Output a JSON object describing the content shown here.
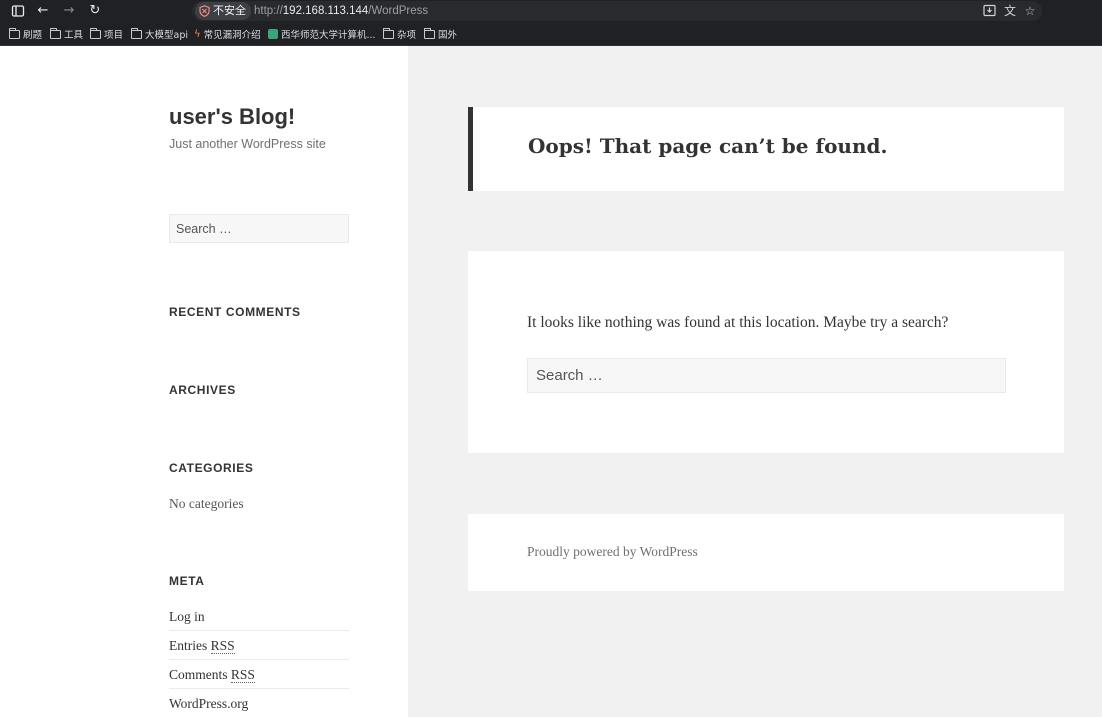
{
  "browser": {
    "security_label": "不安全",
    "url_scheme": "http://",
    "url_host": "192.168.113.144",
    "url_path": "/WordPress",
    "bookmarks": [
      {
        "label": "刷题",
        "icon": "folder-icon"
      },
      {
        "label": "工具",
        "icon": "folder-icon"
      },
      {
        "label": "项目",
        "icon": "folder-icon"
      },
      {
        "label": "大模型api",
        "icon": "folder-icon"
      },
      {
        "label": "常见漏洞介绍",
        "icon": "bolt-icon"
      },
      {
        "label": "西华师范大学计算机...",
        "icon": "site-icon"
      },
      {
        "label": "杂项",
        "icon": "folder-icon"
      },
      {
        "label": "国外",
        "icon": "folder-icon"
      }
    ]
  },
  "site": {
    "title": "user's Blog!",
    "description": "Just another WordPress site"
  },
  "sidebar": {
    "search_placeholder": "Search …",
    "recent_comments_title": "RECENT COMMENTS",
    "archives_title": "ARCHIVES",
    "categories_title": "CATEGORIES",
    "categories_empty": "No categories",
    "meta_title": "META",
    "meta_links": {
      "login": "Log in",
      "entries_prefix": "Entries ",
      "comments_prefix": "Comments ",
      "rss": "RSS",
      "wordpress_org": "WordPress.org"
    }
  },
  "main": {
    "error_title": "Oops! That page can’t be found.",
    "error_text": "It looks like nothing was found at this location. Maybe try a search?",
    "search_placeholder": "Search …",
    "footer_text": "Proudly powered by WordPress"
  }
}
